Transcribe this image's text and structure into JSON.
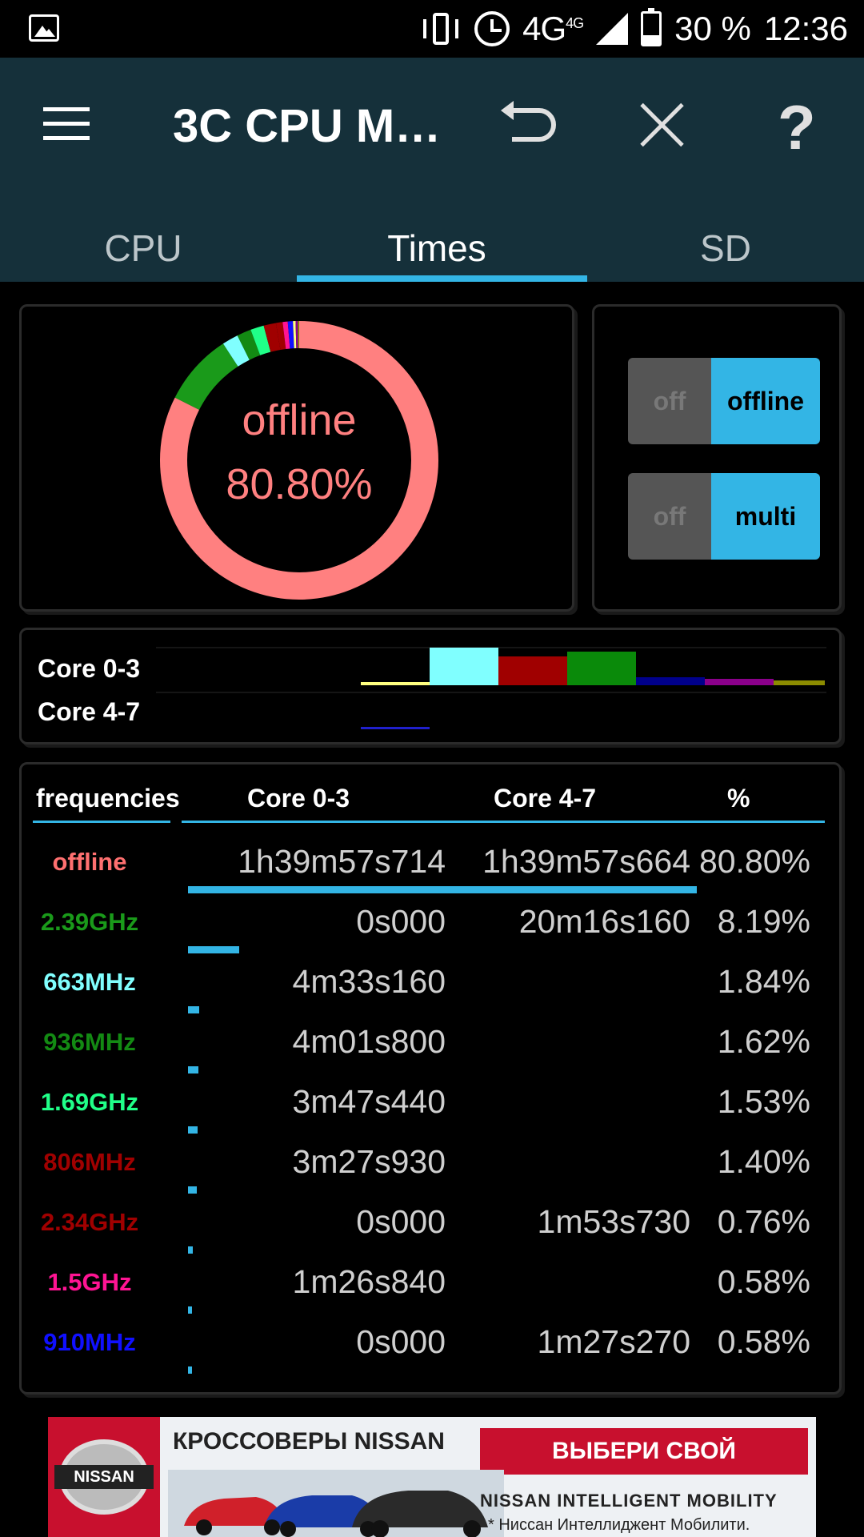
{
  "status_bar": {
    "network": "4G",
    "network_small": "4G",
    "battery": "30 %",
    "battery_level": 0.3,
    "time": "12:36"
  },
  "app": {
    "title": "3C CPU M…",
    "icons": [
      "menu-icon",
      "undo-icon",
      "close-icon",
      "help-icon"
    ],
    "help_glyph": "?"
  },
  "tabs": [
    {
      "label": "CPU",
      "selected": false
    },
    {
      "label": "Times",
      "selected": true
    },
    {
      "label": "SD",
      "selected": false
    }
  ],
  "donut": {
    "label": "offline",
    "value": "80.80%",
    "colors": {
      "accent": "#ff8080",
      "ring": "#ff8080"
    }
  },
  "toggles": {
    "offline": {
      "off": "off",
      "on": "offline",
      "state": "on"
    },
    "multi": {
      "off": "off",
      "on": "multi",
      "state": "on"
    }
  },
  "cores": {
    "labels": [
      "Core 0-3",
      "Core 4-7"
    ]
  },
  "table": {
    "headers": {
      "freq": "frequencies",
      "c03": "Core 0-3",
      "c47": "Core 4-7",
      "pct": "%"
    },
    "rows": [
      {
        "freq": "offline",
        "color": "#ff7070",
        "c03": "1h39m57s714",
        "c47": "1h39m57s664",
        "pct": "80.80%",
        "value": 80.8
      },
      {
        "freq": "2.39GHz",
        "color": "#1a9a1a",
        "c03": "0s000",
        "c47": "20m16s160",
        "pct": "8.19%",
        "value": 8.19
      },
      {
        "freq": "663MHz",
        "color": "#80ffff",
        "c03": "4m33s160",
        "c47": "",
        "pct": "1.84%",
        "value": 1.84
      },
      {
        "freq": "936MHz",
        "color": "#138a13",
        "c03": "4m01s800",
        "c47": "",
        "pct": "1.62%",
        "value": 1.62
      },
      {
        "freq": "1.69GHz",
        "color": "#20ff88",
        "c03": "3m47s440",
        "c47": "",
        "pct": "1.53%",
        "value": 1.53
      },
      {
        "freq": "806MHz",
        "color": "#a00000",
        "c03": "3m27s930",
        "c47": "",
        "pct": "1.40%",
        "value": 1.4
      },
      {
        "freq": "2.34GHz",
        "color": "#a00000",
        "c03": "0s000",
        "c47": "1m53s730",
        "pct": "0.76%",
        "value": 0.76
      },
      {
        "freq": "1.5GHz",
        "color": "#ff1493",
        "c03": "1m26s840",
        "c47": "",
        "pct": "0.58%",
        "value": 0.58
      },
      {
        "freq": "910MHz",
        "color": "#1010ff",
        "c03": "0s000",
        "c47": "1m27s270",
        "pct": "0.58%",
        "value": 0.58
      }
    ]
  },
  "ad": {
    "logo_text": "NISSAN",
    "headline": "КРОССОВЕРЫ NISSAN",
    "button": "ВЫБЕРИ СВОЙ",
    "slogan": "NISSAN INTELLIGENT MOBILITY",
    "subtext": "* Ниссан Интеллиджент Мобилити."
  }
}
